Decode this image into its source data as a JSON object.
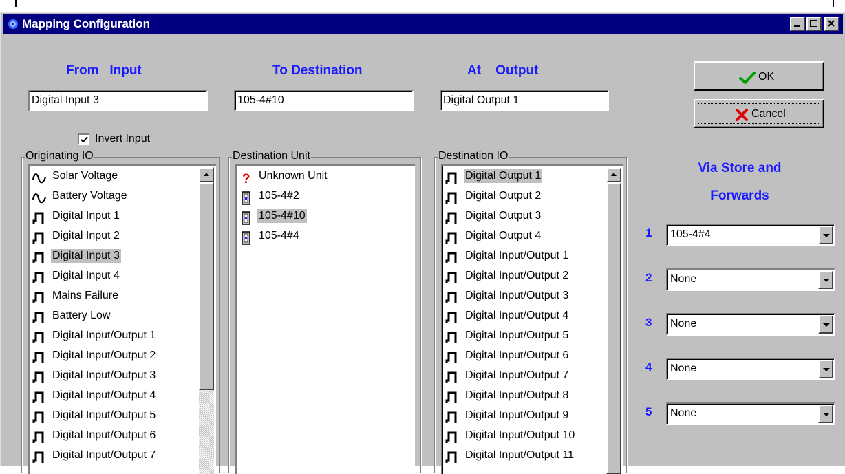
{
  "window": {
    "title": "Mapping Configuration"
  },
  "headings": {
    "from_input": "From   Input",
    "to_destination": "To Destination",
    "at_output": "At    Output"
  },
  "fields": {
    "from_input": "Digital Input 3",
    "to_destination": "105-4#10",
    "at_output": "Digital Output 1"
  },
  "invert_input": {
    "label": "Invert Input",
    "checked": true
  },
  "originating_io": {
    "label": "Originating IO",
    "items": [
      {
        "label": "Solar Voltage",
        "icon": "analog-wave-icon"
      },
      {
        "label": "Battery Voltage",
        "icon": "analog-wave-icon"
      },
      {
        "label": "Digital Input 1",
        "icon": "digital-pulse-icon"
      },
      {
        "label": "Digital Input 2",
        "icon": "digital-pulse-icon"
      },
      {
        "label": "Digital Input 3",
        "icon": "digital-pulse-icon",
        "selected": true
      },
      {
        "label": "Digital Input 4",
        "icon": "digital-pulse-icon"
      },
      {
        "label": "Mains Failure",
        "icon": "digital-pulse-icon"
      },
      {
        "label": "Battery Low",
        "icon": "digital-pulse-icon"
      },
      {
        "label": "Digital Input/Output 1",
        "icon": "digital-pulse-icon"
      },
      {
        "label": "Digital Input/Output 2",
        "icon": "digital-pulse-icon"
      },
      {
        "label": "Digital Input/Output 3",
        "icon": "digital-pulse-icon"
      },
      {
        "label": "Digital Input/Output 4",
        "icon": "digital-pulse-icon"
      },
      {
        "label": "Digital Input/Output 5",
        "icon": "digital-pulse-icon"
      },
      {
        "label": "Digital Input/Output 6",
        "icon": "digital-pulse-icon"
      },
      {
        "label": "Digital Input/Output 7",
        "icon": "digital-pulse-icon"
      }
    ]
  },
  "destination_unit": {
    "label": "Destination Unit",
    "items": [
      {
        "label": "Unknown Unit",
        "icon": "question-mark-icon"
      },
      {
        "label": "105-4#2",
        "icon": "rtu-unit-icon"
      },
      {
        "label": "105-4#10",
        "icon": "rtu-unit-icon",
        "selected": true
      },
      {
        "label": "105-4#4",
        "icon": "rtu-unit-icon"
      }
    ]
  },
  "destination_io": {
    "label": "Destination IO",
    "items": [
      {
        "label": "Digital Output 1",
        "icon": "digital-pulse-icon",
        "selected": true
      },
      {
        "label": "Digital Output 2",
        "icon": "digital-pulse-icon"
      },
      {
        "label": "Digital Output 3",
        "icon": "digital-pulse-icon"
      },
      {
        "label": "Digital Output 4",
        "icon": "digital-pulse-icon"
      },
      {
        "label": "Digital Input/Output 1",
        "icon": "digital-pulse-icon"
      },
      {
        "label": "Digital Input/Output 2",
        "icon": "digital-pulse-icon"
      },
      {
        "label": "Digital Input/Output 3",
        "icon": "digital-pulse-icon"
      },
      {
        "label": "Digital Input/Output 4",
        "icon": "digital-pulse-icon"
      },
      {
        "label": "Digital Input/Output 5",
        "icon": "digital-pulse-icon"
      },
      {
        "label": "Digital Input/Output 6",
        "icon": "digital-pulse-icon"
      },
      {
        "label": "Digital Input/Output 7",
        "icon": "digital-pulse-icon"
      },
      {
        "label": "Digital Input/Output 8",
        "icon": "digital-pulse-icon"
      },
      {
        "label": "Digital Input/Output 9",
        "icon": "digital-pulse-icon"
      },
      {
        "label": "Digital Input/Output 10",
        "icon": "digital-pulse-icon"
      },
      {
        "label": "Digital Input/Output 11",
        "icon": "digital-pulse-icon"
      }
    ]
  },
  "buttons": {
    "ok": "OK",
    "cancel": "Cancel"
  },
  "via": {
    "title_line1": "Via Store and",
    "title_line2": "Forwards",
    "slots": [
      {
        "num": "1",
        "value": "105-4#4"
      },
      {
        "num": "2",
        "value": "None"
      },
      {
        "num": "3",
        "value": "None"
      },
      {
        "num": "4",
        "value": "None"
      },
      {
        "num": "5",
        "value": "None"
      }
    ]
  },
  "colors": {
    "titlebar": "#000080",
    "heading_blue": "#1a1aff",
    "face": "#c0c0c0",
    "ok_check": "#00a000",
    "cancel_x": "#e00000",
    "question": "#e00000"
  }
}
